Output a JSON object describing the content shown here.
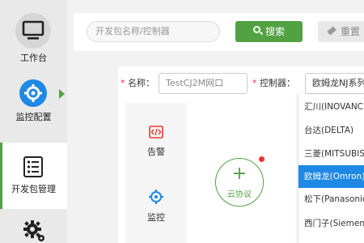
{
  "sidebar": {
    "items": [
      {
        "label": "工作台",
        "icon": "monitor-icon"
      },
      {
        "label": "监控配置",
        "icon": "monitor-config-icon"
      },
      {
        "label": "开发包管理",
        "icon": "package-list-icon"
      },
      {
        "label": "",
        "icon": "settings-gear-icon"
      }
    ],
    "active_index": 2,
    "accent": "#52a142"
  },
  "toolbar": {
    "search_placeholder": "开发包名称/控制器",
    "search_label": "搜索",
    "reset_label": "重置"
  },
  "form": {
    "name_label": "名称：",
    "name_value": "TestCJ2M网口",
    "controller_label": "控制器：",
    "controller_value": "欧姆龙NJ系列"
  },
  "tiles": [
    {
      "label": "告警",
      "icon": "alarm-code-icon"
    },
    {
      "label": "监控",
      "icon": "monitor-target-icon"
    }
  ],
  "cloud_button": {
    "plus": "+",
    "label": "云协议"
  },
  "dropdown": {
    "options": [
      "汇川(INOVANCE",
      "台达(DELTA)",
      "三菱(MITSUBISHI",
      "欧姆龙(Omron)",
      "松下(Panasonic",
      "西门子(Siemens"
    ],
    "selected_index": 3,
    "selected_color": "#1e88e5"
  }
}
